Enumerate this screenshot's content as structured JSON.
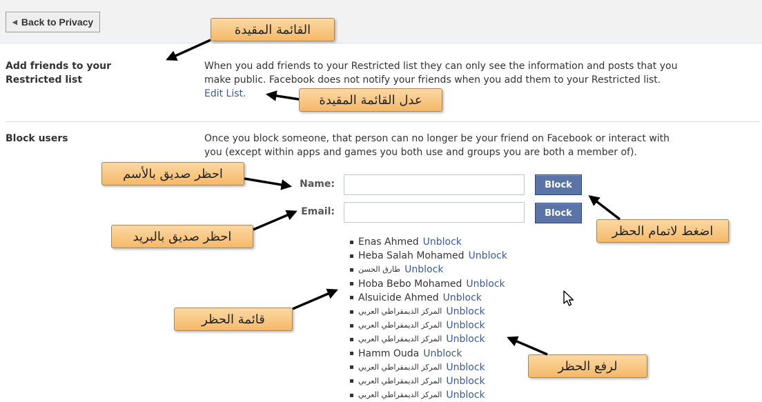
{
  "toolbar": {
    "back_label": "Back to Privacy"
  },
  "restricted": {
    "title_line1": "Add friends to your",
    "title_line2": "Restricted list",
    "text_line1": "When you add friends to your Restricted list they can only see the information and posts that you",
    "text_line2": "make public. Facebook does not notify your friends when you add them to your Restricted list.",
    "edit_link": "Edit List."
  },
  "block": {
    "title": "Block users",
    "text_line1": "Once you block someone, that person can no longer be your friend on Facebook or interact with",
    "text_line2": "you (except within apps and games you both use and groups you are both a member of).",
    "name_label": "Name:",
    "email_label": "Email:",
    "name_value": "",
    "email_value": "",
    "block_label": "Block",
    "unblock_label": "Unblock",
    "blocked_users": [
      "Enas Ahmed",
      "Heba Salah Mohamed",
      "طارق الحسن",
      "Hoba Bebo Mohamed",
      "Alsuicide Ahmed",
      "المركز الديمقراطي العربي",
      "المركز الديمقراطي العربي",
      "المركز الديمقراطي العربي",
      "Hamm Ouda",
      "المركز الديمقراطي العربي",
      "المركز الديمقراطي العربي",
      "المركز الديمقراطي العربي"
    ]
  },
  "callouts": {
    "restricted_list": "القائمة المقيدة",
    "edit_restricted_list": "عدل القائمة المقيدة",
    "block_by_name": "احظر صديق بالأسم",
    "block_by_email": "احظر صديق بالبريد",
    "press_to_block": "اضغط لاتمام الحظر",
    "block_list": "قائمة الحظر",
    "to_unblock": "لرفع الحظر"
  },
  "colors": {
    "link": "#3b5998",
    "block_button": "#5b74a8",
    "callout": "#f5b968"
  }
}
